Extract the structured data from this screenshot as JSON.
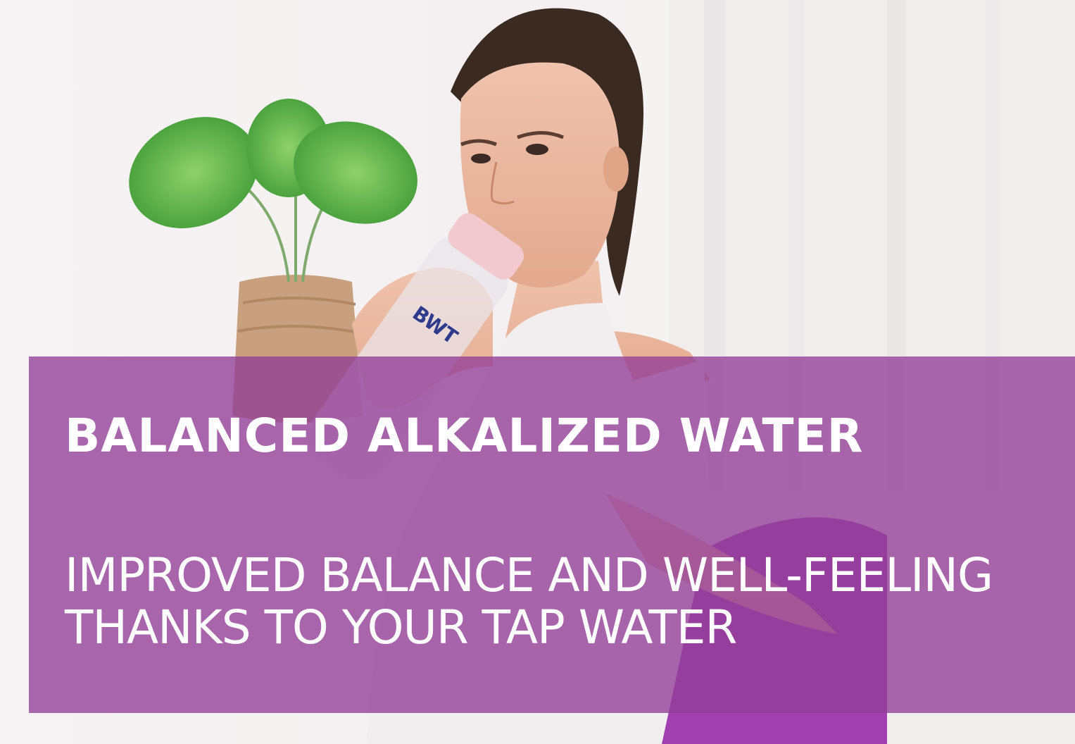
{
  "banner": {
    "headline": "BALANCED ALKALIZED WATER",
    "subline_1": "IMPROVED BALANCE AND WELL-FEELING",
    "subline_2": "THANKS TO YOUR TAP WATER"
  },
  "bottle_logo": "BWT",
  "colors": {
    "overlay": "#923e97",
    "text": "#ffffff",
    "leaves": "#4fa83c",
    "bottle_cap": "#f2c9cf"
  }
}
